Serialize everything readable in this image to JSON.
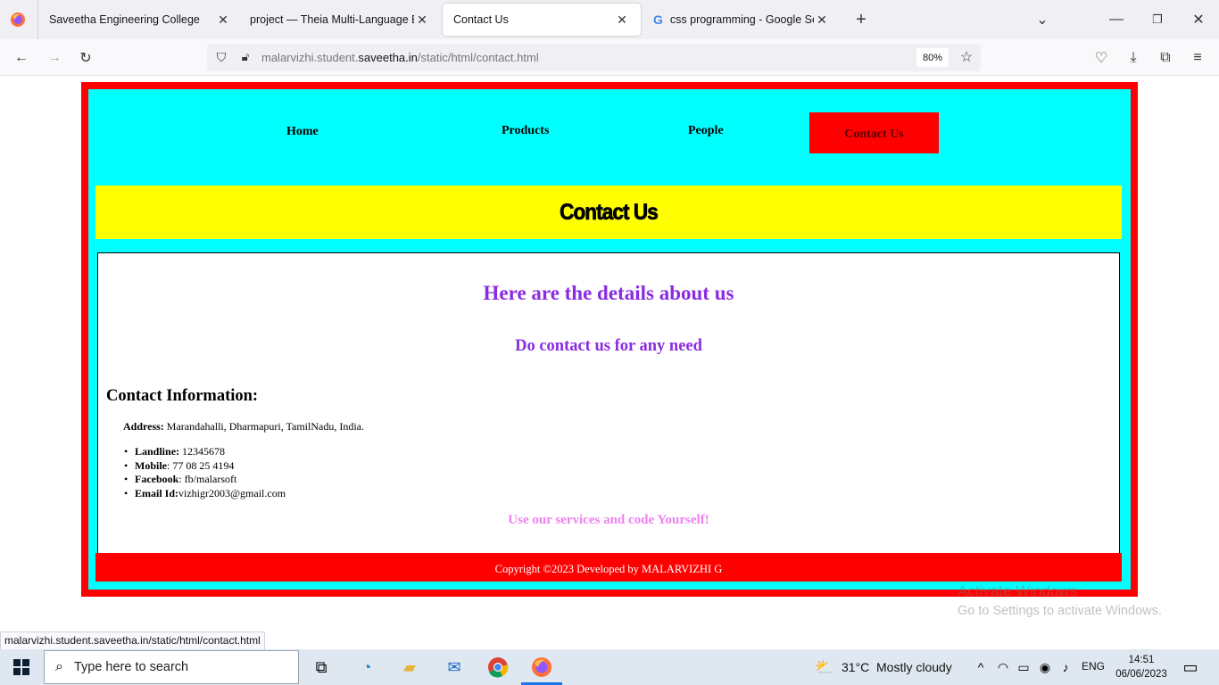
{
  "browser": {
    "tabs": [
      {
        "title": "Saveetha Engineering College",
        "active": false
      },
      {
        "title": "project — Theia Multi-Language Ex",
        "active": false
      },
      {
        "title": "Contact Us",
        "active": true
      },
      {
        "title": "css programming - Google Sear",
        "active": false
      }
    ],
    "url_prefix": "malarvizhi.student.",
    "url_host": "saveetha.in",
    "url_path": "/static/html/contact.html",
    "zoom": "80%",
    "status_url": "malarvizhi.student.saveetha.in/static/html/contact.html"
  },
  "site": {
    "menu": [
      "Home",
      "Products",
      "People",
      "Contact Us"
    ],
    "banner_title": "Contact Us",
    "details_heading": "Here are the details about us",
    "contact_heading": "Do contact us for any need",
    "info_heading": "Contact Information:",
    "address_label": "Address:",
    "address_value": " Marandahalli, Dharmapuri, TamilNadu, India.",
    "contacts": [
      {
        "label": "Landline:",
        "value": " 12345678"
      },
      {
        "label": "Mobile",
        "value": ": 77 08 25 4194"
      },
      {
        "label": "Facebook",
        "value": ": fb/malarsoft"
      },
      {
        "label": "Email Id:",
        "value": "vizhigr2003@gmail.com"
      }
    ],
    "services_text": "Use our services and code Yourself!",
    "footer": "Copyright ©2023 Developed by MALARVIZHI G"
  },
  "watermark": {
    "line1": "Activate Windows",
    "line2": "Go to Settings to activate Windows."
  },
  "taskbar": {
    "search_placeholder": "Type here to search",
    "weather": "31°C",
    "weather_desc": "Mostly cloudy",
    "language": "ENG",
    "time": "14:51",
    "date": "06/06/2023"
  },
  "colors": {
    "frame": "#ff0000",
    "panel": "#00ffff",
    "banner": "#ffff00",
    "heading": "#8a2be2",
    "services": "#ee82ee"
  }
}
